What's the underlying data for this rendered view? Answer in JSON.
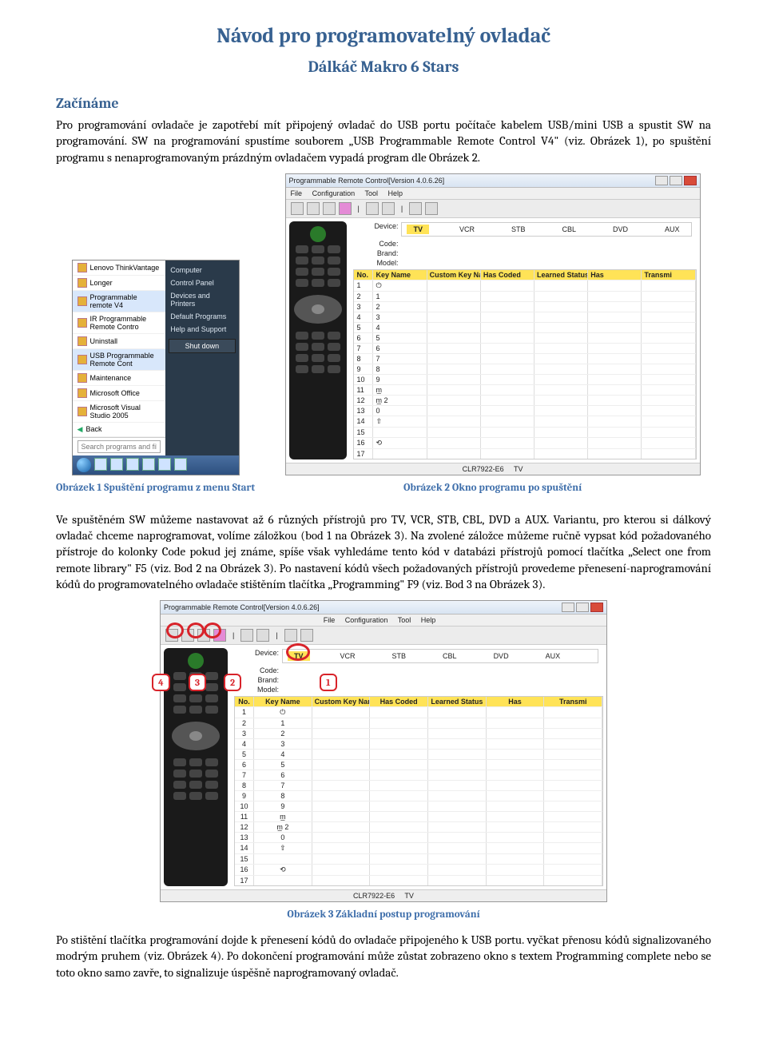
{
  "doc": {
    "title": "Návod pro programovatelný ovladač",
    "subtitle": "Dálkáč Makro 6 Stars",
    "section1_heading": "Začínáme",
    "para1": "Pro programování ovladače je zapotřebí mít připojený ovladač do USB portu počítače kabelem USB/mini USB a spustit SW na programování. SW na programování spustíme souborem „USB Programmable Remote Control V4\" (viz. Obrázek 1), po spuštění programu s nenaprogramovaným prázdným ovladačem vypadá program dle Obrázek 2.",
    "caption1": "Obrázek 1 Spuštění programu z menu Start",
    "caption2": "Obrázek 2 Okno programu po spuštění",
    "para2": "Ve spuštěném SW můžeme nastavovat až 6 různých přístrojů pro TV, VCR, STB, CBL, DVD a AUX. Variantu, pro kterou si dálkový ovladač chceme naprogramovat, volíme záložkou (bod 1 na Obrázek 3). Na zvolené záložce můžeme ručně vypsat kód požadovaného přístroje do kolonky Code pokud jej známe, spíše však vyhledáme tento kód v databázi přístrojů pomocí tlačítka „Select one from remote library\" F5 (viz. Bod 2 na Obrázek 3). Po nastavení kódů všech požadovaných přístrojů provedeme přenesení-naprogramování kódů do programovatelného ovladače stištěním tlačítka „Programming\" F9 (viz. Bod 3 na Obrázek 3).",
    "caption3": "Obrázek 3 Základní postup programování",
    "para3": "Po stištění tlačítka programování dojde k přenesení kódů do ovladače připojeného k USB portu.  vyčkat přenosu kódů signalizovaného modrým pruhem (viz. Obrázek 4). Po dokončení programování může zůstat zobrazeno okno s textem Programming complete nebo se toto okno samo zavře, to signalizuje úspěšně naprogramovaný ovladač."
  },
  "startmenu": {
    "items": [
      {
        "label": "Lenovo ThinkVantage",
        "right": "Computer"
      },
      {
        "label": "Longer",
        "right": "Control Panel"
      },
      {
        "label": "Programmable remote V4",
        "right": "Devices and Printers",
        "highlight": true
      },
      {
        "label": "IR Programmable Remote Contro",
        "right": "Default Programs"
      },
      {
        "label": "Uninstall",
        "right": "Help and Support"
      },
      {
        "label": "USB Programmable Remote Cont",
        "right": ""
      },
      {
        "label": "Maintenance",
        "right": ""
      },
      {
        "label": "Microsoft Office",
        "right": ""
      },
      {
        "label": "Microsoft Visual Studio 2005",
        "right": ""
      }
    ],
    "back": "Back",
    "search_placeholder": "Search programs and files",
    "shutdown": "Shut down"
  },
  "appwin": {
    "title": "Programmable Remote Control[Version 4.0.6.26]",
    "menu": [
      "File",
      "Configuration",
      "Tool",
      "Help"
    ],
    "tabs": [
      "TV",
      "VCR",
      "STB",
      "CBL",
      "DVD",
      "AUX"
    ],
    "info_labels": {
      "device": "Device:",
      "code": "Code:",
      "brand": "Brand:",
      "model": "Model:"
    },
    "grid_headers": [
      "No.",
      "Key Name",
      "Custom Key Name",
      "Has Coded",
      "Learned Status",
      "Has",
      "Transmi"
    ],
    "rows": [
      {
        "n": "1",
        "k": "⏻"
      },
      {
        "n": "2",
        "k": "1"
      },
      {
        "n": "3",
        "k": "2"
      },
      {
        "n": "4",
        "k": "3"
      },
      {
        "n": "5",
        "k": "4"
      },
      {
        "n": "6",
        "k": "5"
      },
      {
        "n": "7",
        "k": "6"
      },
      {
        "n": "8",
        "k": "7"
      },
      {
        "n": "9",
        "k": "8"
      },
      {
        "n": "10",
        "k": "9"
      },
      {
        "n": "11",
        "k": "m̲"
      },
      {
        "n": "12",
        "k": "m̲ 2"
      },
      {
        "n": "13",
        "k": "0"
      },
      {
        "n": "14",
        "k": "⇧"
      },
      {
        "n": "15",
        "k": ""
      },
      {
        "n": "16",
        "k": "⟲"
      },
      {
        "n": "17",
        "k": ""
      }
    ],
    "status_left": "CLR7922-E6",
    "status_right": "TV"
  },
  "markers": {
    "m1": "1",
    "m2": "2",
    "m3": "3",
    "m4": "4"
  }
}
